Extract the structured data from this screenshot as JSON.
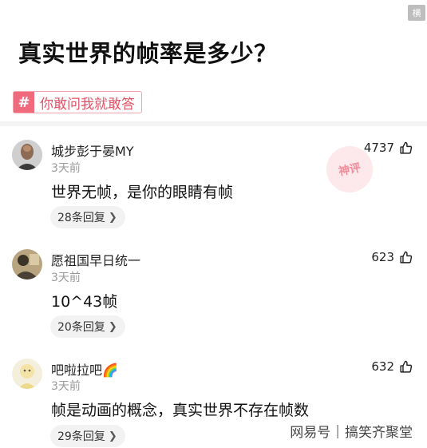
{
  "corner_tag": "横",
  "post": {
    "title": "真实世界的帧率是多少？",
    "tag": {
      "icon": "#",
      "label": "你敢问我就敢答"
    }
  },
  "stamp_text": "神评",
  "comments": [
    {
      "name": "城步彭于晏MY",
      "time": "3天前",
      "text": "世界无帧，是你的眼睛有帧",
      "replies": "28条回复",
      "likes": "4737",
      "emoji": ""
    },
    {
      "name": "愿祖国早日统一",
      "time": "3天前",
      "text": "10^43帧",
      "replies": "20条回复",
      "likes": "623",
      "emoji": ""
    },
    {
      "name": "吧啦拉吧",
      "time": "3天前",
      "text": "帧是动画的概念，真实世界不存在帧数",
      "replies": "29条回复",
      "likes": "632",
      "emoji": "🌈"
    }
  ],
  "watermark": {
    "brand": "网易号",
    "account": "搞笑齐聚堂"
  },
  "icons": {
    "like": "thumbs-up-icon",
    "chevron": "chevron-right-icon",
    "hashtag": "hashtag-icon"
  },
  "colors": {
    "tag_accent": "#f06a7e",
    "tag_text": "#e25267"
  }
}
